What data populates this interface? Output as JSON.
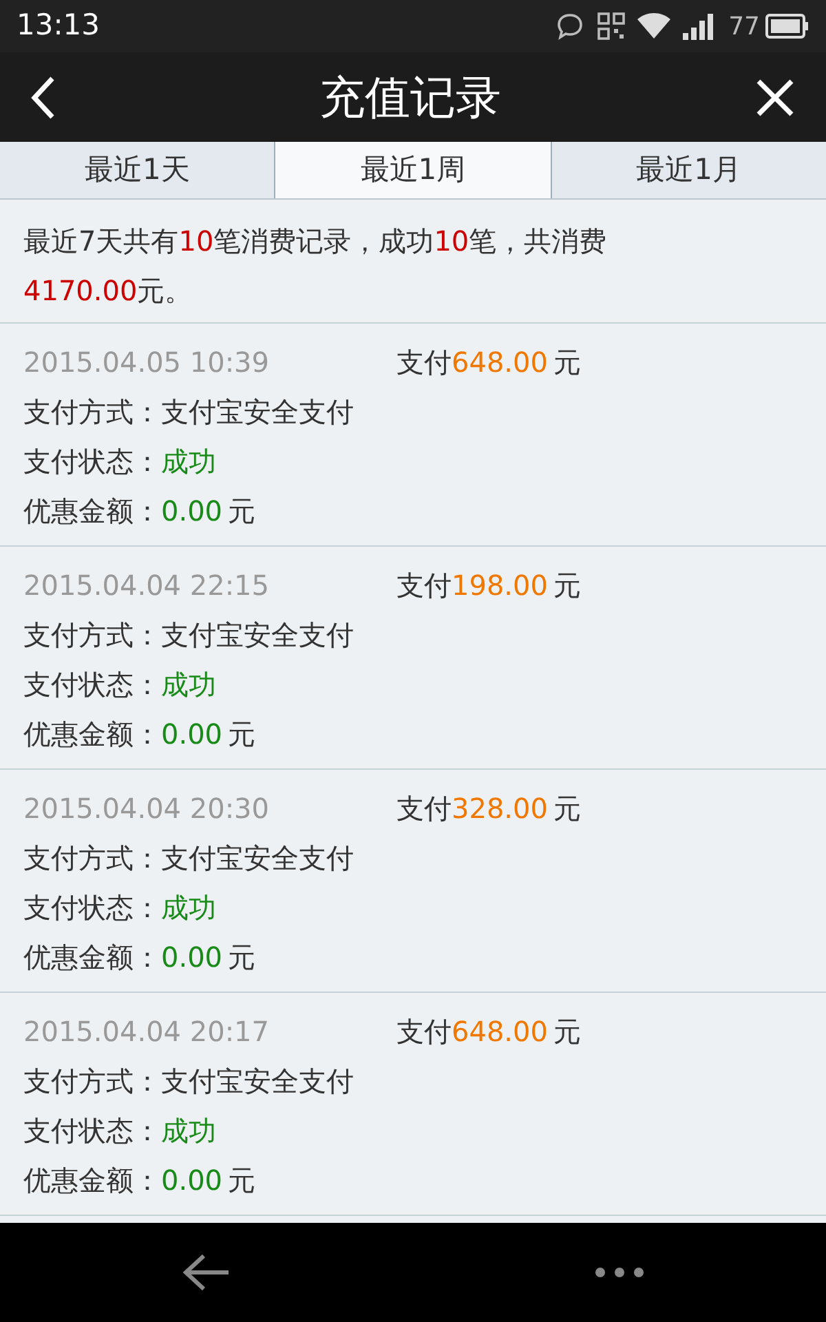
{
  "status_bar": {
    "time": "13:13",
    "battery": "77"
  },
  "header": {
    "title": "充值记录"
  },
  "tabs": [
    {
      "label": "最近1天",
      "selected": false
    },
    {
      "label": "最近1周",
      "selected": true
    },
    {
      "label": "最近1月",
      "selected": false
    }
  ],
  "summary": [
    {
      "text": "最近7天共有",
      "highlight": false
    },
    {
      "text": "10",
      "highlight": true
    },
    {
      "text": "笔消费记录，成功",
      "highlight": false
    },
    {
      "text": "10",
      "highlight": true
    },
    {
      "text": "笔，共消费",
      "highlight": false
    },
    {
      "text": "4170.00",
      "highlight": true
    },
    {
      "text": "元。",
      "highlight": false
    }
  ],
  "records": [
    {
      "time": "2015.04.05 10:39",
      "pay_label": "支付",
      "amount": "648.00",
      "unit": "元",
      "method_label": "支付方式：",
      "method": "支付宝安全支付",
      "status_label": "支付状态：",
      "status": "成功",
      "discount_label": "优惠金额：",
      "discount": "0.00",
      "discount_unit": "元"
    },
    {
      "time": "2015.04.04 22:15",
      "pay_label": "支付",
      "amount": "198.00",
      "unit": "元",
      "method_label": "支付方式：",
      "method": "支付宝安全支付",
      "status_label": "支付状态：",
      "status": "成功",
      "discount_label": "优惠金额：",
      "discount": "0.00",
      "discount_unit": "元"
    },
    {
      "time": "2015.04.04 20:30",
      "pay_label": "支付",
      "amount": "328.00",
      "unit": "元",
      "method_label": "支付方式：",
      "method": "支付宝安全支付",
      "status_label": "支付状态：",
      "status": "成功",
      "discount_label": "优惠金额：",
      "discount": "0.00",
      "discount_unit": "元"
    },
    {
      "time": "2015.04.04 20:17",
      "pay_label": "支付",
      "amount": "648.00",
      "unit": "元",
      "method_label": "支付方式：",
      "method": "支付宝安全支付",
      "status_label": "支付状态：",
      "status": "成功",
      "discount_label": "优惠金额：",
      "discount": "0.00",
      "discount_unit": "元"
    }
  ]
}
